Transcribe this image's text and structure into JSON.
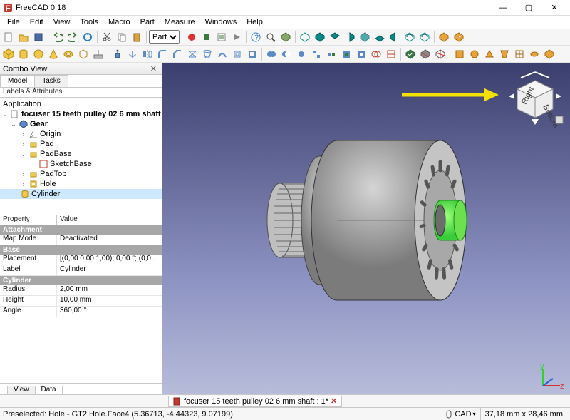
{
  "window": {
    "title": "FreeCAD 0.18",
    "min": "—",
    "max": "▢",
    "close": "✕"
  },
  "menu": [
    "File",
    "Edit",
    "View",
    "Tools",
    "Macro",
    "Part",
    "Measure",
    "Windows",
    "Help"
  ],
  "workbench": {
    "value": "Part"
  },
  "combo": {
    "title": "Combo View",
    "tabs": [
      "Model",
      "Tasks"
    ],
    "labels_attr": "Labels & Attributes",
    "app": "Application",
    "root": "focuser 15 teeth pulley 02 6 mm shaft",
    "gear": "Gear",
    "origin": "Origin",
    "pad": "Pad",
    "padbase": "PadBase",
    "sketchbase": "SketchBase",
    "padtop": "PadTop",
    "hole": "Hole",
    "cylinder": "Cylinder"
  },
  "props": {
    "head_k": "Property",
    "head_v": "Value",
    "g1": "Attachment",
    "mapmode_k": "Map Mode",
    "mapmode_v": "Deactivated",
    "g2": "Base",
    "placement_k": "Placement",
    "placement_v": "[(0,00 0,00 1,00); 0,00 °; (0,00 m...",
    "label_k": "Label",
    "label_v": "Cylinder",
    "g3": "Cylinder",
    "radius_k": "Radius",
    "radius_v": "2,00 mm",
    "height_k": "Height",
    "height_v": "10,00 mm",
    "angle_k": "Angle",
    "angle_v": "360,00 °"
  },
  "bottom_tabs": [
    "View",
    "Data"
  ],
  "doc": {
    "name": "focuser 15 teeth pulley 02 6 mm shaft : 1*",
    "close": "✕"
  },
  "status": {
    "preselect": "Preselected: Hole - GT2.Hole.Face4 (5.36713, -4.44323, 9.07199)",
    "cad": "CAD",
    "dim": "37,18 mm x 28,46 mm"
  },
  "navcube": {
    "right": "Right",
    "bottom": "Bottom"
  }
}
